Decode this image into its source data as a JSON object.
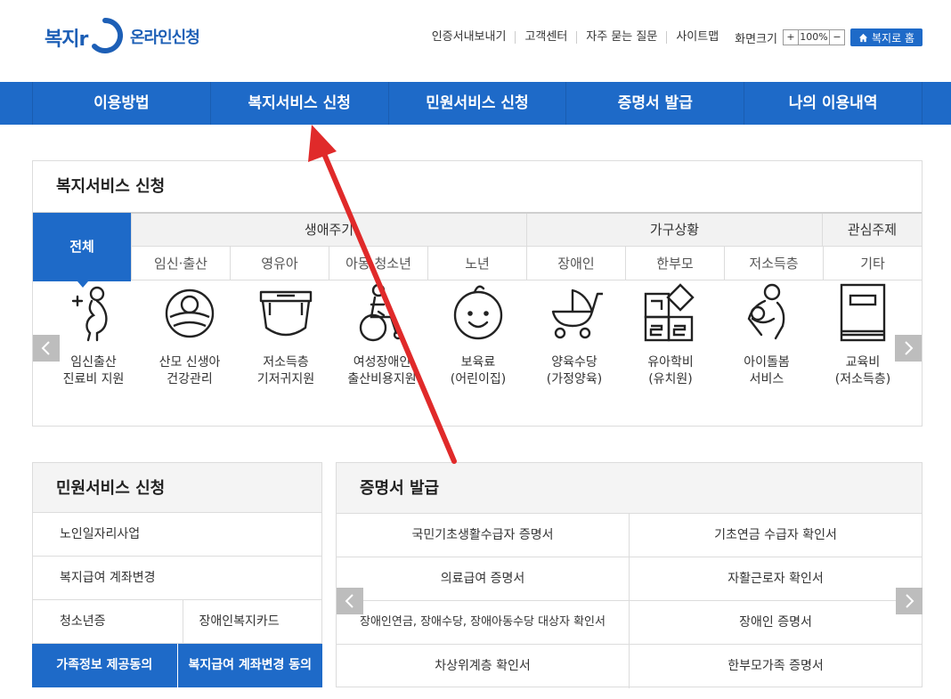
{
  "header": {
    "logo_text": "복지r",
    "logo_sub": "온라인신청",
    "links": [
      "인증서내보내기",
      "고객센터",
      "자주 묻는 질문",
      "사이트맵"
    ],
    "zoom_label": "화면크기",
    "zoom_plus": "+",
    "zoom_value": "100%",
    "zoom_minus": "−",
    "home_label": "복지로 홈",
    "home_icon": "home-icon"
  },
  "nav": [
    "이용방법",
    "복지서비스 신청",
    "민원서비스 신청",
    "증명서 발급",
    "나의 이용내역"
  ],
  "welfare": {
    "title": "복지서비스 신청",
    "all_tab": "전체",
    "groups": [
      "생애주기",
      "가구상황",
      "관심주제"
    ],
    "subs": [
      "임신·출산",
      "영유아",
      "아동·청소년",
      "노년",
      "장애인",
      "한부모",
      "저소득층",
      "기타"
    ],
    "services": [
      {
        "line1": "임신출산",
        "line2": "진료비 지원",
        "icon": "pregnancy-icon"
      },
      {
        "line1": "산모 신생아",
        "line2": "건강관리",
        "icon": "baby-basket-icon"
      },
      {
        "line1": "저소득층",
        "line2": "기저귀지원",
        "icon": "diaper-icon"
      },
      {
        "line1": "여성장애인",
        "line2": "출산비용지원",
        "icon": "wheelchair-icon"
      },
      {
        "line1": "보육료",
        "line2": "(어린이집)",
        "icon": "baby-face-icon"
      },
      {
        "line1": "양육수당",
        "line2": "(가정양육)",
        "icon": "stroller-icon"
      },
      {
        "line1": "유아학비",
        "line2": "(유치원)",
        "icon": "blocks-icon"
      },
      {
        "line1": "아이돌봄",
        "line2": "서비스",
        "icon": "caregiver-icon"
      },
      {
        "line1": "교육비",
        "line2": "(저소득층)",
        "icon": "book-icon"
      }
    ]
  },
  "civil": {
    "title": "민원서비스 신청",
    "items": [
      "노인일자리사업",
      "복지급여 계좌변경"
    ],
    "split": [
      "청소년증",
      "장애인복지카드"
    ],
    "buttons": [
      "가족정보 제공동의",
      "복지급여 계좌변경 동의"
    ]
  },
  "cert": {
    "title": "증명서 발급",
    "items": [
      "국민기초생활수급자 증명서",
      "기초연금 수급자 확인서",
      "의료급여 증명서",
      "자활근로자 확인서",
      "장애인연금, 장애수당, 장애아동수당 대상자 확인서",
      "장애인 증명서",
      "차상위계층 확인서",
      "한부모가족 증명서"
    ]
  },
  "colors": {
    "brand": "#1e6ac8",
    "annotation_arrow": "#e02a2a"
  }
}
